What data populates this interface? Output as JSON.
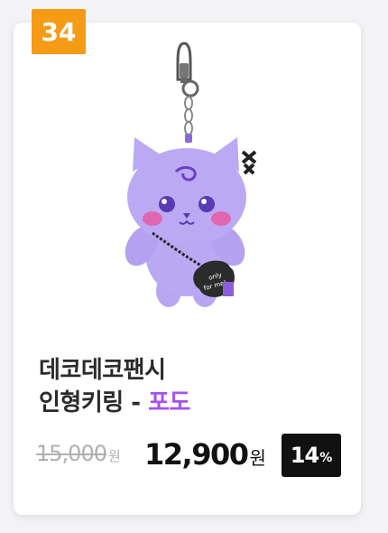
{
  "rank": "34",
  "product": {
    "name": "데코데코팬시",
    "subtitle": "인형키링",
    "separator": " - ",
    "variant": "포도",
    "tag_text": "only for me!",
    "image_icon": "plush-cat-keyring-image"
  },
  "pricing": {
    "original": "15,000",
    "original_unit": "원",
    "sale": "12,900",
    "sale_unit": "원",
    "discount": "14",
    "discount_unit": "%"
  },
  "colors": {
    "rank_badge": "#f59b16",
    "variant_text": "#a652f0",
    "discount_badge": "#111111",
    "plush": "#b9a6f2"
  }
}
